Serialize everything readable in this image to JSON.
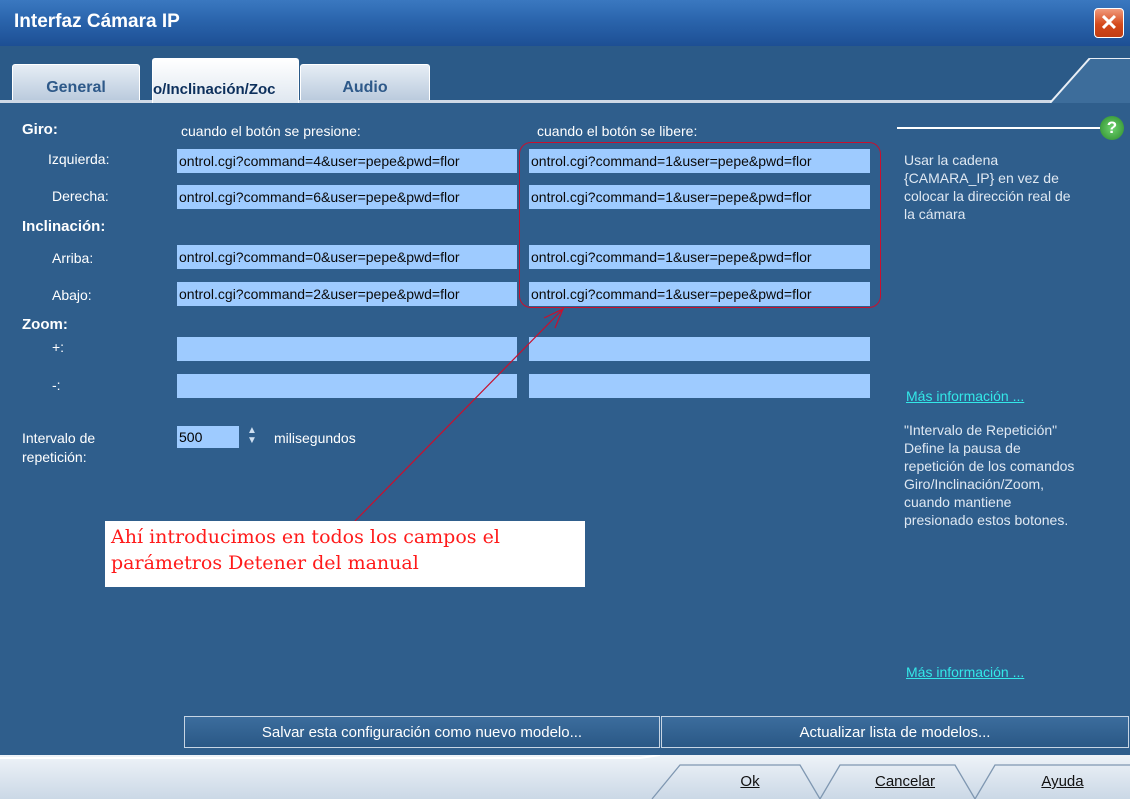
{
  "window": {
    "title": "Interfaz Cámara IP",
    "close_glyph": "✕"
  },
  "tabs": [
    {
      "label": "General"
    },
    {
      "label": "o/Inclinación/Zoc"
    },
    {
      "label": "Audio"
    }
  ],
  "columns": {
    "pressed": "cuando el botón se presione:",
    "released": "cuando el botón se libere:"
  },
  "sections": {
    "pan": "Giro:",
    "tilt": "Inclinación:",
    "zoom": "Zoom:"
  },
  "rows": [
    {
      "label": "Izquierda:",
      "pressed": "ontrol.cgi?command=4&user=pepe&pwd=flor",
      "released": "ontrol.cgi?command=1&user=pepe&pwd=flor"
    },
    {
      "label": "Derecha:",
      "pressed": "ontrol.cgi?command=6&user=pepe&pwd=flor",
      "released": "ontrol.cgi?command=1&user=pepe&pwd=flor"
    },
    {
      "label": "Arriba:",
      "pressed": "ontrol.cgi?command=0&user=pepe&pwd=flor",
      "released": "ontrol.cgi?command=1&user=pepe&pwd=flor"
    },
    {
      "label": "Abajo:",
      "pressed": "ontrol.cgi?command=2&user=pepe&pwd=flor",
      "released": "ontrol.cgi?command=1&user=pepe&pwd=flor"
    },
    {
      "label": "+:",
      "pressed": "",
      "released": ""
    },
    {
      "label": "-:",
      "pressed": "",
      "released": ""
    }
  ],
  "repeat": {
    "label_line1": "Intervalo de",
    "label_line2": "repetición:",
    "value": "500",
    "unit": "milisegundos"
  },
  "annotation": {
    "line1": "Ahí introducimos en todos los campos el",
    "line2": "parámetros Detener del manual"
  },
  "help": {
    "icon_glyph": "?",
    "hint1": [
      "Usar la cadena",
      "{CAMARA_IP} en vez de",
      "colocar la dirección real de",
      "la cámara"
    ],
    "link1": "Más información ...",
    "hint2": [
      "\"Intervalo de Repetición\"",
      "Define la pausa de",
      "repetición de los comandos",
      "Giro/Inclinación/Zoom,",
      "cuando mantiene",
      "presionado estos botones."
    ],
    "link2": "Más información ..."
  },
  "buttons": {
    "save_model": "Salvar esta configuración como nuevo modelo...",
    "refresh_models": "Actualizar lista de modelos...",
    "ok": "Ok",
    "cancel": "Cancelar",
    "help": "Ayuda"
  }
}
